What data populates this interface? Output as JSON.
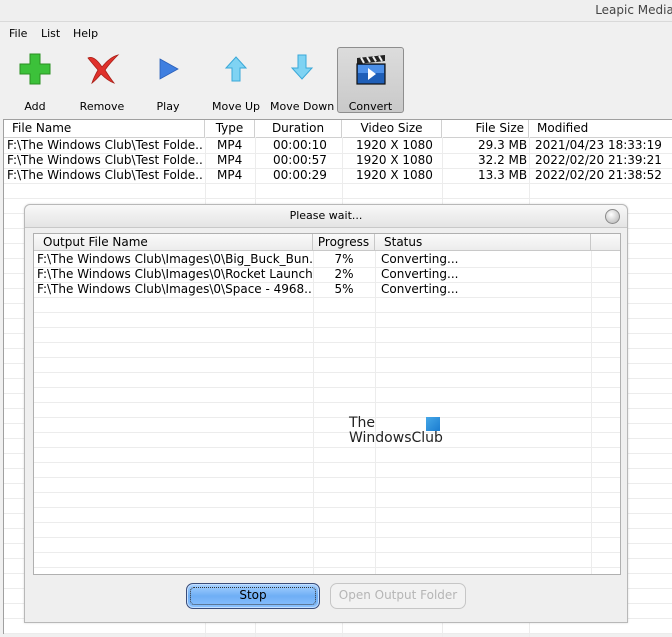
{
  "window": {
    "title": "Leapic Media C"
  },
  "menu": [
    "File",
    "List",
    "Help"
  ],
  "toolbar": [
    {
      "label": "Add",
      "icon": "add-icon"
    },
    {
      "label": "Remove",
      "icon": "remove-icon"
    },
    {
      "label": "Play",
      "icon": "play-icon"
    },
    {
      "label": "Move Up",
      "icon": "arrow-up-icon"
    },
    {
      "label": "Move Down",
      "icon": "arrow-down-icon"
    },
    {
      "label": "Convert",
      "icon": "clapperboard-icon",
      "active": true
    }
  ],
  "file_list": {
    "columns": [
      "File Name",
      "Type",
      "Duration",
      "Video Size",
      "File Size",
      "Modified"
    ],
    "rows": [
      [
        "F:\\The Windows Club\\Test Folde...",
        "MP4",
        "00:00:10",
        "1920 X 1080",
        "29.3 MB",
        "2021/04/23 18:33:19"
      ],
      [
        "F:\\The Windows Club\\Test Folde...",
        "MP4",
        "00:00:57",
        "1920 X 1080",
        "32.2 MB",
        "2022/02/20 21:39:21"
      ],
      [
        "F:\\The Windows Club\\Test Folde...",
        "MP4",
        "00:00:29",
        "1920 X 1080",
        "13.3 MB",
        "2022/02/20 21:38:52"
      ]
    ]
  },
  "dialog": {
    "title": "Please wait...",
    "columns": [
      "Output File Name",
      "Progress",
      "Status"
    ],
    "rows": [
      [
        "F:\\The Windows Club\\Images\\0\\Big_Buck_Bun...",
        "7%",
        "Converting..."
      ],
      [
        "F:\\The Windows Club\\Images\\0\\Rocket Launch...",
        "2%",
        "Converting..."
      ],
      [
        "F:\\The Windows Club\\Images\\0\\Space - 4968....",
        "5%",
        "Converting..."
      ]
    ],
    "stop_label": "Stop",
    "open_folder_label": "Open Output Folder"
  },
  "watermark": {
    "line1": "The",
    "line2": "WindowsClub"
  },
  "colors": {
    "accent_button": "#6faef5",
    "disabled_text": "#b5b5b5"
  }
}
